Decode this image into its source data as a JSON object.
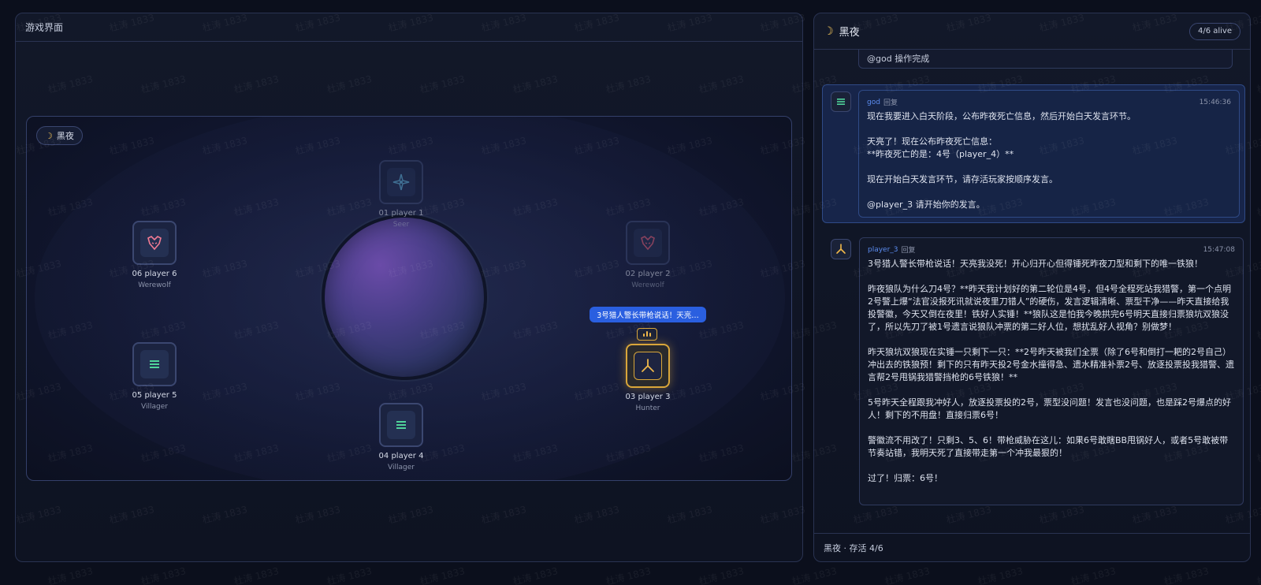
{
  "left_panel": {
    "title": "游戏界面",
    "phase_label": "黑夜",
    "speech_bubble": "3号猎人警长带枪说话！天亮…"
  },
  "players": [
    {
      "name": "01 player 1",
      "role": "Seer",
      "status": "dim",
      "icon": "seer-star-icon"
    },
    {
      "name": "02 player 2",
      "role": "Werewolf",
      "status": "dim",
      "icon": "werewolf-icon"
    },
    {
      "name": "03 player 3",
      "role": "Hunter",
      "status": "active",
      "icon": "hunter-icon"
    },
    {
      "name": "04 player 4",
      "role": "Villager",
      "status": "alive",
      "icon": "villager-icon"
    },
    {
      "name": "05 player 5",
      "role": "Villager",
      "status": "alive",
      "icon": "villager-icon"
    },
    {
      "name": "06 player 6",
      "role": "Werewolf",
      "status": "alive",
      "icon": "werewolf-icon"
    }
  ],
  "right_panel": {
    "title": "黑夜",
    "alive_badge": "4/6 alive",
    "footer": "黑夜 · 存活 4/6"
  },
  "messages": {
    "stub_text": "@god 操作完成",
    "god": {
      "author": "god",
      "reply": "回复",
      "time": "15:46:36",
      "text": "现在我要进入白天阶段，公布昨夜死亡信息，然后开始白天发言环节。\n\n天亮了！现在公布昨夜死亡信息：\n**昨夜死亡的是：4号（player_4）**\n\n现在开始白天发言环节，请存活玩家按顺序发言。\n\n@player_3 请开始你的发言。"
    },
    "player3": {
      "author": "player_3",
      "reply": "回复",
      "time": "15:47:08",
      "text": "3号猎人警长带枪说话！天亮我没死！开心归开心但得锤死昨夜刀型和剩下的唯一铁狼！\n\n昨夜狼队为什么刀4号？**昨天我计划好的第二轮位是4号，但4号全程死站我猎警，第一个点明2号警上爆“法官没报死讯就说夜里刀错人”的硬伤，发言逻辑清晰、票型干净——昨天直接给我投警徽，今天又倒在夜里！铁好人实锤！**狼队这是怕我今晚拱完6号明天直接归票狼坑双狼没了，所以先刀了被1号遗言说狼队冲票的第二好人位，想扰乱好人视角？别做梦！\n\n昨天狼坑双狼现在实锤一只剩下一只：**2号昨天被我们全票（除了6号和倒打一耙的2号自己）冲出去的铁狼预！剩下的只有昨天投2号金水撞得急、遗水精准补票2号、放逐投票投我猎警、遗言帮2号甩锅我猎警挡枪的6号铁狼！**\n\n5号昨天全程跟我冲好人，放逐投票投的2号，票型没问题！发言也没问题，也是踩2号爆点的好人！剩下的不用盘！直接归票6号！\n\n警徽流不用改了！只剩3、5、6！带枪威胁在这儿：如果6号敢瞎BB甩锅好人，或者5号敢被带节奏站错，我明天死了直接带走第一个冲我最狠的！\n\n过了！归票：6号！"
    }
  },
  "watermark": "杜涛 1833"
}
